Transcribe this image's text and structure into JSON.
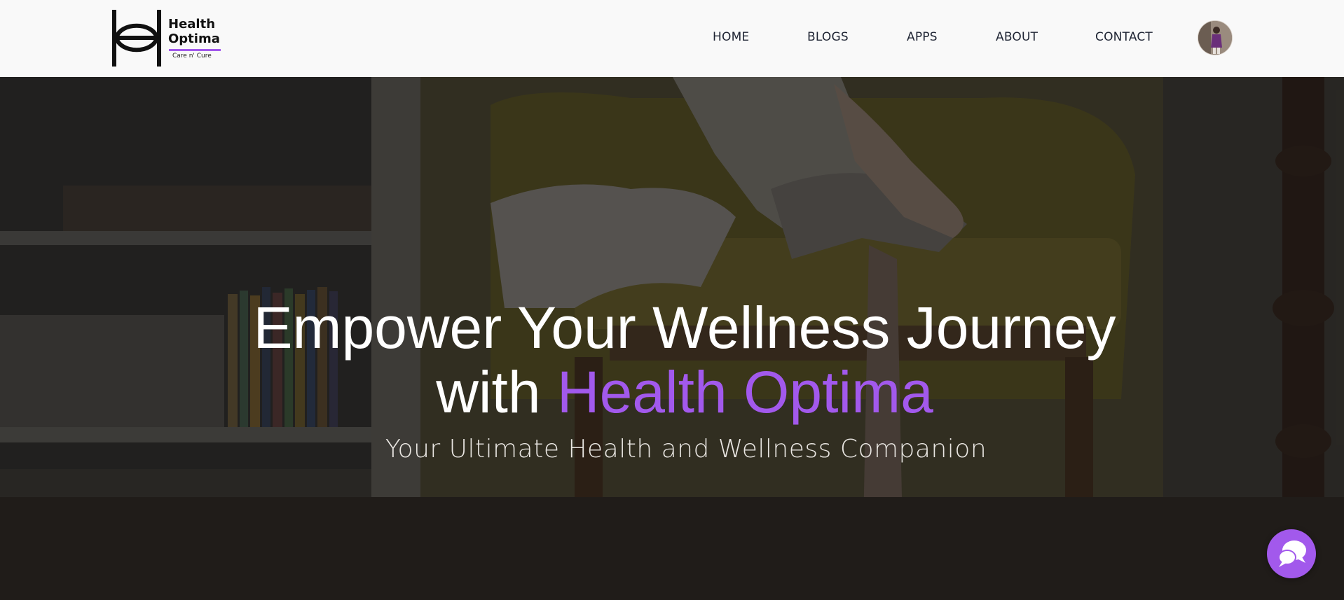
{
  "brand": {
    "name_line1": "Health",
    "name_line2": "Optima",
    "name": "Health\nOptima",
    "tagline": "Care n' Cure",
    "accent_color": "#a259ec"
  },
  "nav": {
    "items": [
      {
        "label": "HOME"
      },
      {
        "label": "BLOGS"
      },
      {
        "label": "APPS"
      },
      {
        "label": "ABOUT"
      },
      {
        "label": "CONTACT"
      }
    ],
    "avatar_icon": "user-avatar"
  },
  "hero": {
    "title_line1": "Empower Your Wellness Journey",
    "title_with": "with ",
    "title_brand": "Health Optima",
    "subtitle": "Your Ultimate Health and Wellness Companion",
    "background": "dimmed photo of a person relaxing in a yellow armchair beside a bookshelf"
  },
  "chat": {
    "icon": "chat-bubbles-icon",
    "color": "#a259ec"
  }
}
